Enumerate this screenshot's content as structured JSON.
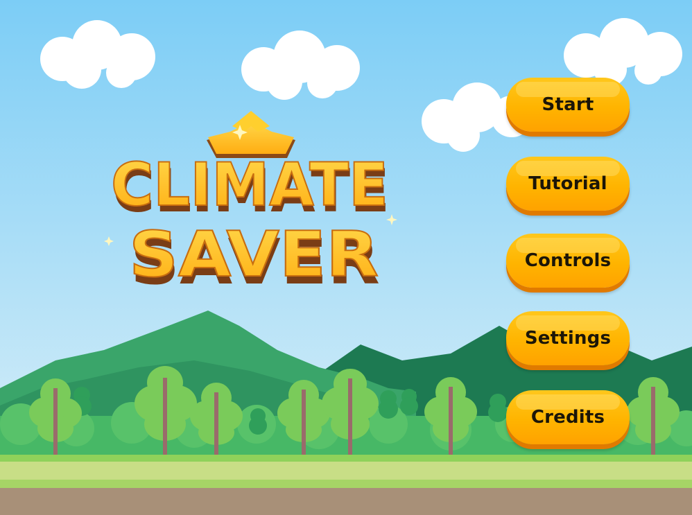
{
  "title": {
    "line1": "CLIMATE",
    "line2": "SAVER"
  },
  "menu": {
    "items": [
      {
        "label": "Start"
      },
      {
        "label": "Tutorial"
      },
      {
        "label": "Controls"
      },
      {
        "label": "Settings"
      },
      {
        "label": "Credits"
      }
    ]
  },
  "colors": {
    "sky_top": "#7ccdf6",
    "sky_bottom": "#dff1f8",
    "mountain": "#3aa56a",
    "mountain_dark": "#1d7a52",
    "grass": "#7fc356",
    "path": "#a89078",
    "button": "#ffb400",
    "button_shadow": "#e07a00",
    "title_gold": "#ffc21a",
    "title_brown": "#7a3d16"
  }
}
